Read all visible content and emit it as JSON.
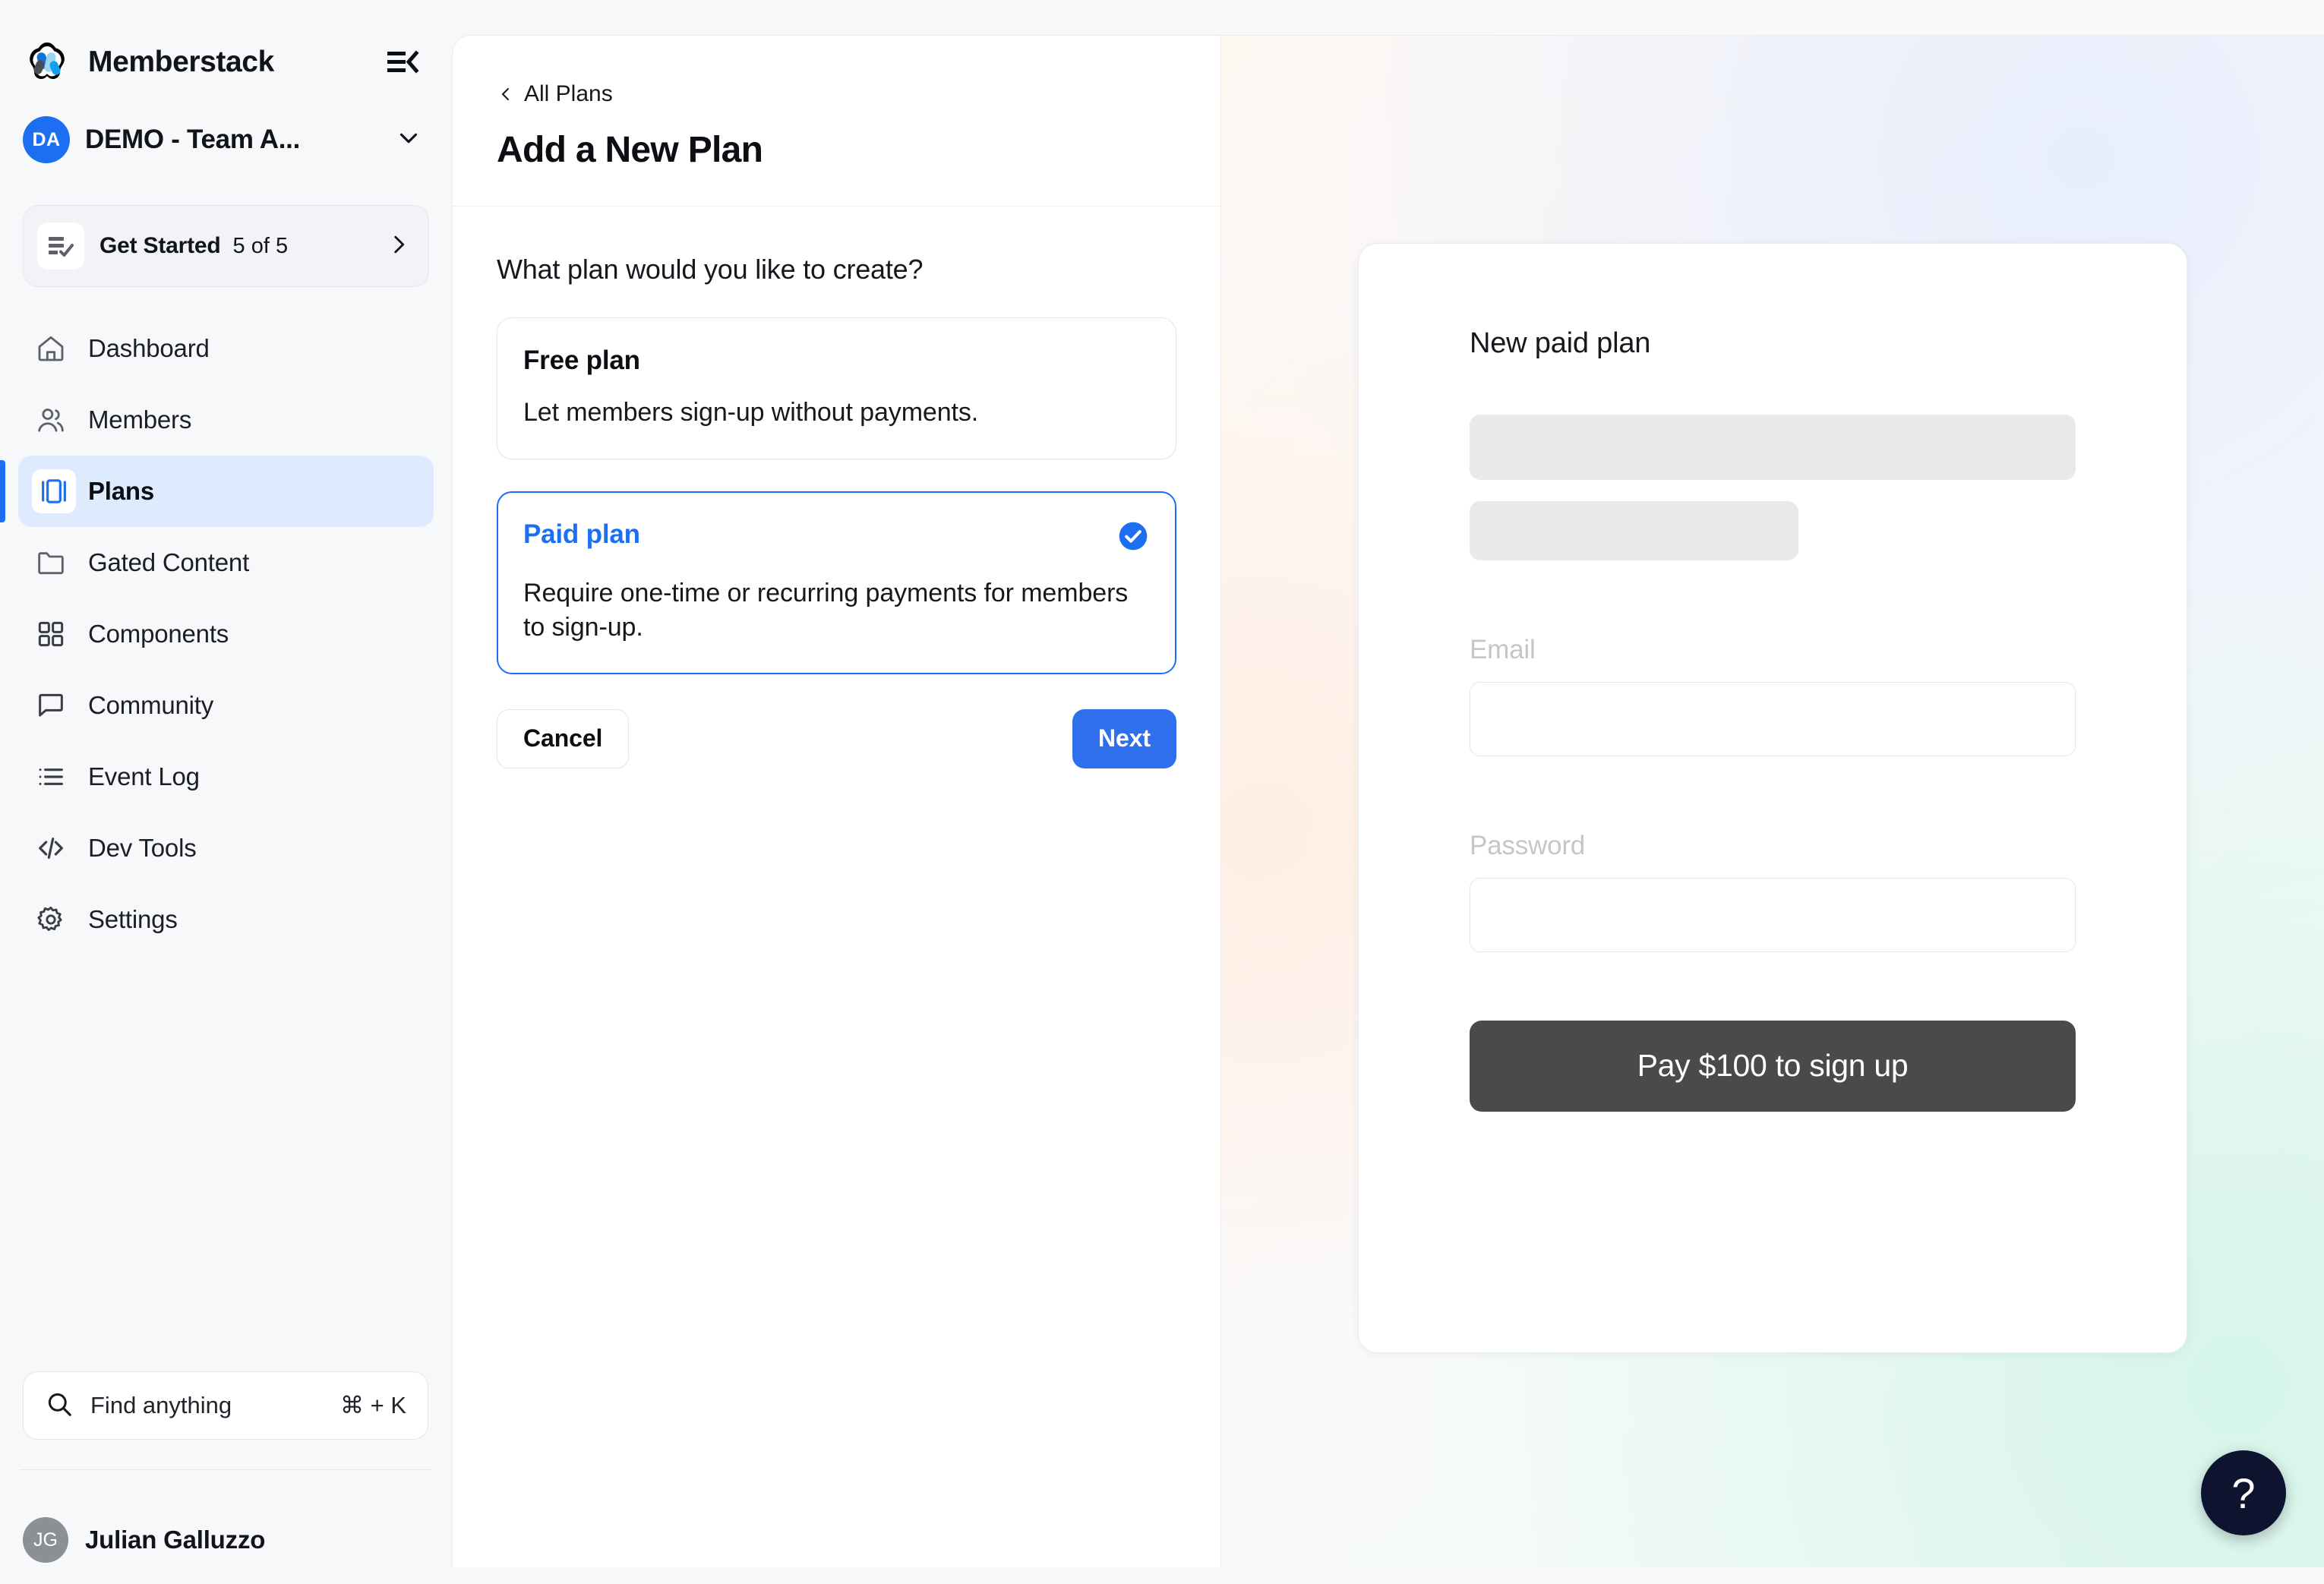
{
  "sidebar": {
    "brand": {
      "name": "Memberstack",
      "logo_icon": "memberstack-logo"
    },
    "collapse_icon": "collapse-sidebar-icon",
    "team": {
      "initials": "DA",
      "name": "DEMO - Team A...",
      "chevron_icon": "chevron-down-icon"
    },
    "get_started": {
      "icon": "checklist-icon",
      "title": "Get Started",
      "count": "5 of 5",
      "progress_percent": 100,
      "chevron_icon": "chevron-right-icon"
    },
    "nav_items": [
      {
        "label": "Dashboard",
        "icon": "home-icon",
        "active": false
      },
      {
        "label": "Members",
        "icon": "users-icon",
        "active": false
      },
      {
        "label": "Plans",
        "icon": "plans-icon",
        "active": true
      },
      {
        "label": "Gated Content",
        "icon": "folder-icon",
        "active": false
      },
      {
        "label": "Components",
        "icon": "grid-icon",
        "active": false
      },
      {
        "label": "Community",
        "icon": "chat-bubble-icon",
        "active": false
      },
      {
        "label": "Event Log",
        "icon": "list-icon",
        "active": false
      },
      {
        "label": "Dev Tools",
        "icon": "code-icon",
        "active": false
      },
      {
        "label": "Settings",
        "icon": "gear-icon",
        "active": false
      }
    ],
    "search": {
      "icon": "search-icon",
      "placeholder": "Find anything",
      "shortcut": "⌘ + K"
    },
    "user": {
      "initials": "JG",
      "name": "Julian Galluzzo"
    }
  },
  "main": {
    "breadcrumb": {
      "label": "All Plans",
      "icon": "chevron-left-icon"
    },
    "title": "Add a New Plan",
    "question": "What plan would you like to create?",
    "plan_options": [
      {
        "title": "Free plan",
        "description": "Let members sign-up without payments.",
        "selected": false
      },
      {
        "title": "Paid plan",
        "description": "Require one-time or recurring payments for members to sign-up.",
        "selected": true,
        "check_icon": "check-circle-icon"
      }
    ],
    "cancel_label": "Cancel",
    "next_label": "Next"
  },
  "preview": {
    "title": "New paid plan",
    "email_label": "Email",
    "email_value": "",
    "password_label": "Password",
    "password_value": "",
    "pay_button_label": "Pay $100 to sign up"
  },
  "help": {
    "label": "?",
    "icon": "question-mark-icon"
  },
  "colors": {
    "accent_blue": "#1D6FF2",
    "button_blue": "#2F6FED",
    "active_nav_bg": "#DEEAFD",
    "pay_button": "#4A4A4A",
    "help_fab": "#0E1430",
    "sidebar_bg": "#F7F8FA"
  }
}
